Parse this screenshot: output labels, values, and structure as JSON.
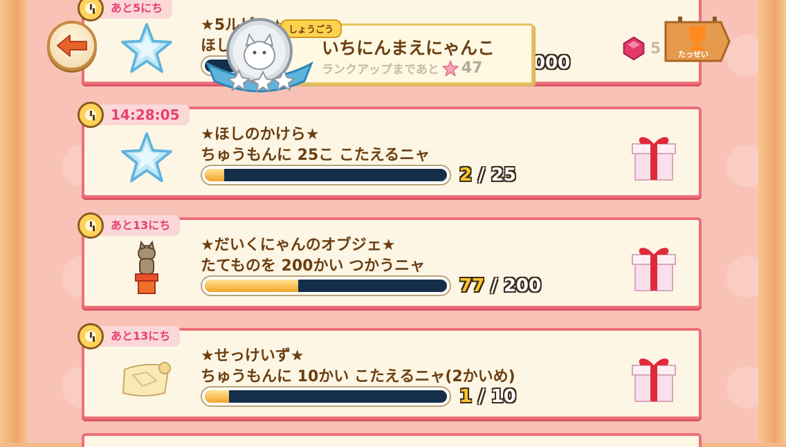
{
  "rank": {
    "tag": "しょうごう",
    "name": "いちにんまえにゃんこ",
    "sub_label": "ランクアップまであと",
    "sub_value": "47"
  },
  "header": {
    "ruby_count": "5",
    "trophy_label": "たっせい",
    "top_score": ",000"
  },
  "top_card": {
    "timer": "あと5にち",
    "title": "★5ルビー★",
    "desc": "ほし"
  },
  "quests": [
    {
      "timer": "14:28:05",
      "title": "★ほしのかけら★",
      "desc": "ちゅうもんに 25こ こたえるニャ",
      "current": "2",
      "sep": "/",
      "total": "25",
      "progress": 0.08,
      "icon": "star-icon"
    },
    {
      "timer": "あと13にち",
      "title": "★だいくにゃんのオブジェ★",
      "desc": "たてものを 200かい つかうニャ",
      "current": "77",
      "sep": "/",
      "total": "200",
      "progress": 0.385,
      "icon": "cat-statue-icon"
    },
    {
      "timer": "あと13にち",
      "title": "★せっけいず★",
      "desc": "ちゅうもんに 10かい こたえるニャ(2かいめ)",
      "current": "1",
      "sep": "/",
      "total": "10",
      "progress": 0.1,
      "icon": "blueprint-icon"
    }
  ],
  "colors": {
    "card_border": "#ee6f79",
    "text_brown": "#6b3e12",
    "bar_dark": "#152f4a",
    "bar_fill": "#f2a52a"
  }
}
